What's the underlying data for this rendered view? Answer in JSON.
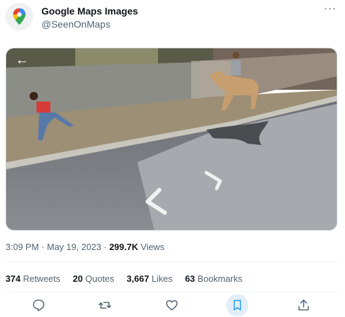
{
  "author": {
    "name": "Google Maps Images",
    "handle": "@SeenOnMaps",
    "avatar_icon": "google-maps-pin-icon"
  },
  "menu_icon": "more-options-icon",
  "media": {
    "back_icon": "back-arrow-icon",
    "scene": "street-view"
  },
  "meta": {
    "time": "3:09 PM",
    "sep1": " · ",
    "date": "May 19, 2023",
    "sep2": " · ",
    "views_count": "299.7K",
    "views_label": "Views"
  },
  "stats": [
    {
      "count": "374",
      "label": "Retweets"
    },
    {
      "count": "20",
      "label": "Quotes"
    },
    {
      "count": "3,667",
      "label": "Likes"
    },
    {
      "count": "63",
      "label": "Bookmarks"
    }
  ],
  "actions": [
    "reply-icon",
    "retweet-icon",
    "like-icon",
    "bookmark-icon",
    "share-icon"
  ],
  "colors": {
    "text": "#0f1419",
    "muted": "#536471",
    "accent": "#1d9bf0"
  }
}
